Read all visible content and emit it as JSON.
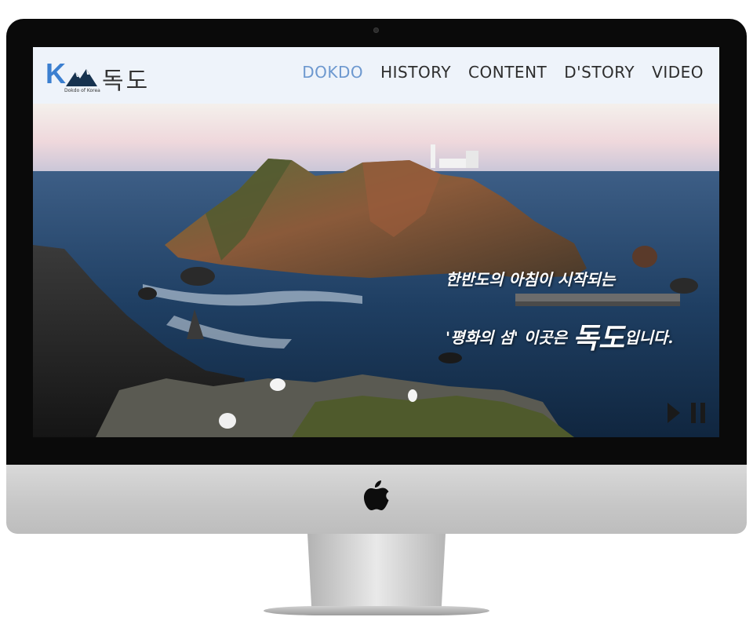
{
  "site": {
    "logo_letter": "K",
    "logo_sub": "Dokdo of Korea",
    "logo_title": "독도"
  },
  "nav": {
    "items": [
      {
        "label": "DOKDO",
        "active": true
      },
      {
        "label": "HISTORY",
        "active": false
      },
      {
        "label": "CONTENT",
        "active": false
      },
      {
        "label": "D'STORY",
        "active": false
      },
      {
        "label": "VIDEO",
        "active": false
      }
    ]
  },
  "hero": {
    "line1": "한반도의 아침이 시작되는",
    "line2_a": "'평화의 섬' 이곳은 ",
    "line2_big": "독도",
    "line2_b": "입니다."
  },
  "colors": {
    "nav_active": "#6d98cf",
    "nav_default": "#2d2d2d",
    "header_bg": "#eef3fa",
    "logo_accent": "#3b7fd0"
  },
  "icons": {
    "play": "play-icon",
    "pause": "pause-icon",
    "brand": "apple-icon"
  }
}
